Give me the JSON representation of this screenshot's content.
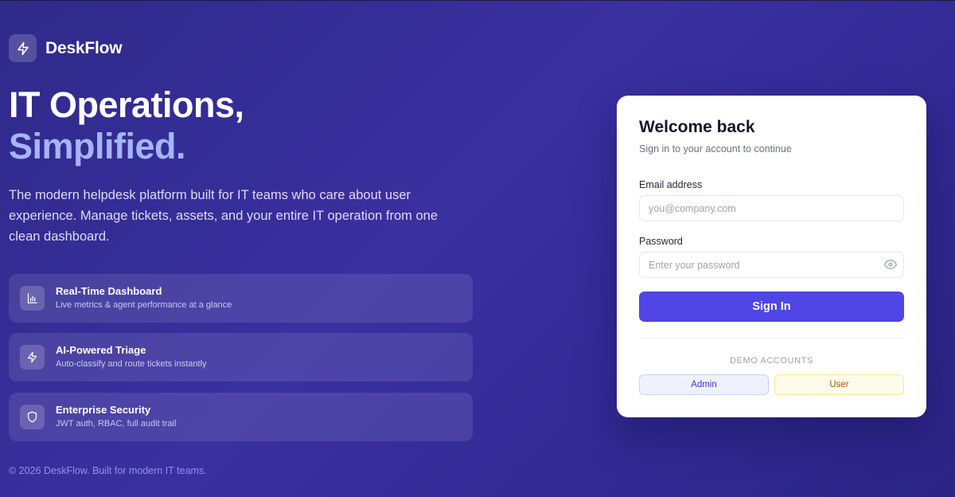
{
  "brand": {
    "name": "DeskFlow",
    "icon": "lightning-icon"
  },
  "hero": {
    "title_line1": "IT Operations,",
    "title_line2": "Simplified.",
    "description": "The modern helpdesk platform built for IT teams who care about user experience. Manage tickets, assets, and your entire IT operation from one clean dashboard."
  },
  "features": [
    {
      "icon": "bar-chart-icon",
      "title": "Real-Time Dashboard",
      "description": "Live metrics & agent performance at a glance"
    },
    {
      "icon": "lightning-icon",
      "title": "AI-Powered Triage",
      "description": "Auto-classify and route tickets instantly"
    },
    {
      "icon": "shield-icon",
      "title": "Enterprise Security",
      "description": "JWT auth, RBAC, full audit trail"
    }
  ],
  "footer": {
    "text": "© 2026 DeskFlow. Built for modern IT teams."
  },
  "login": {
    "title": "Welcome back",
    "subtitle": "Sign in to your account to continue",
    "email_label": "Email address",
    "email_placeholder": "you@company.com",
    "email_value": "",
    "password_label": "Password",
    "password_placeholder": "Enter your password",
    "password_value": "",
    "password_toggle_icon": "eye-icon",
    "submit_label": "Sign In",
    "demo_label": "DEMO ACCOUNTS",
    "demo_admin_label": "Admin",
    "demo_user_label": "User"
  },
  "colors": {
    "background": "#332a95",
    "accent": "#4f46e5",
    "highlight": "#a5b4fc",
    "card": "#ffffff",
    "admin_badge_bg": "#eef2ff",
    "user_badge_bg": "#fffbeb"
  }
}
